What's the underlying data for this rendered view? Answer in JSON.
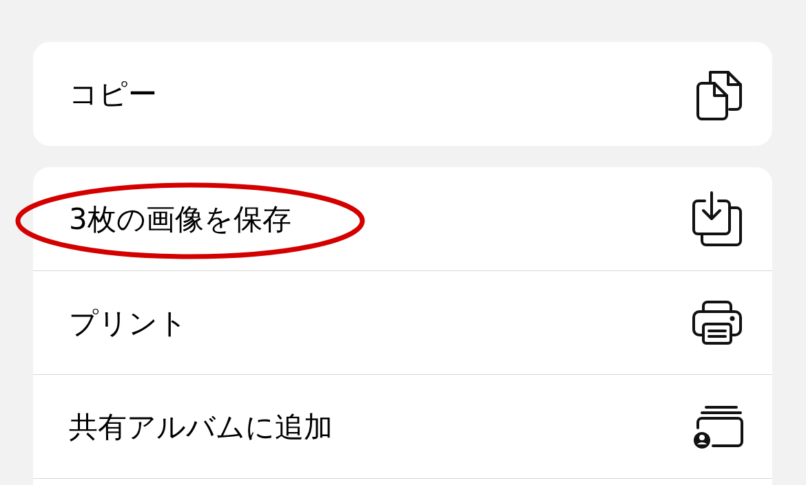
{
  "groups": [
    {
      "items": [
        {
          "label": "コピー",
          "kind": "copy",
          "highlighted": false
        }
      ]
    },
    {
      "items": [
        {
          "label": "3枚の画像を保存",
          "kind": "save",
          "highlighted": true
        },
        {
          "label": "プリント",
          "kind": "print",
          "highlighted": false
        },
        {
          "label": "共有アルバムに追加",
          "kind": "shared-album",
          "highlighted": false
        }
      ]
    }
  ]
}
